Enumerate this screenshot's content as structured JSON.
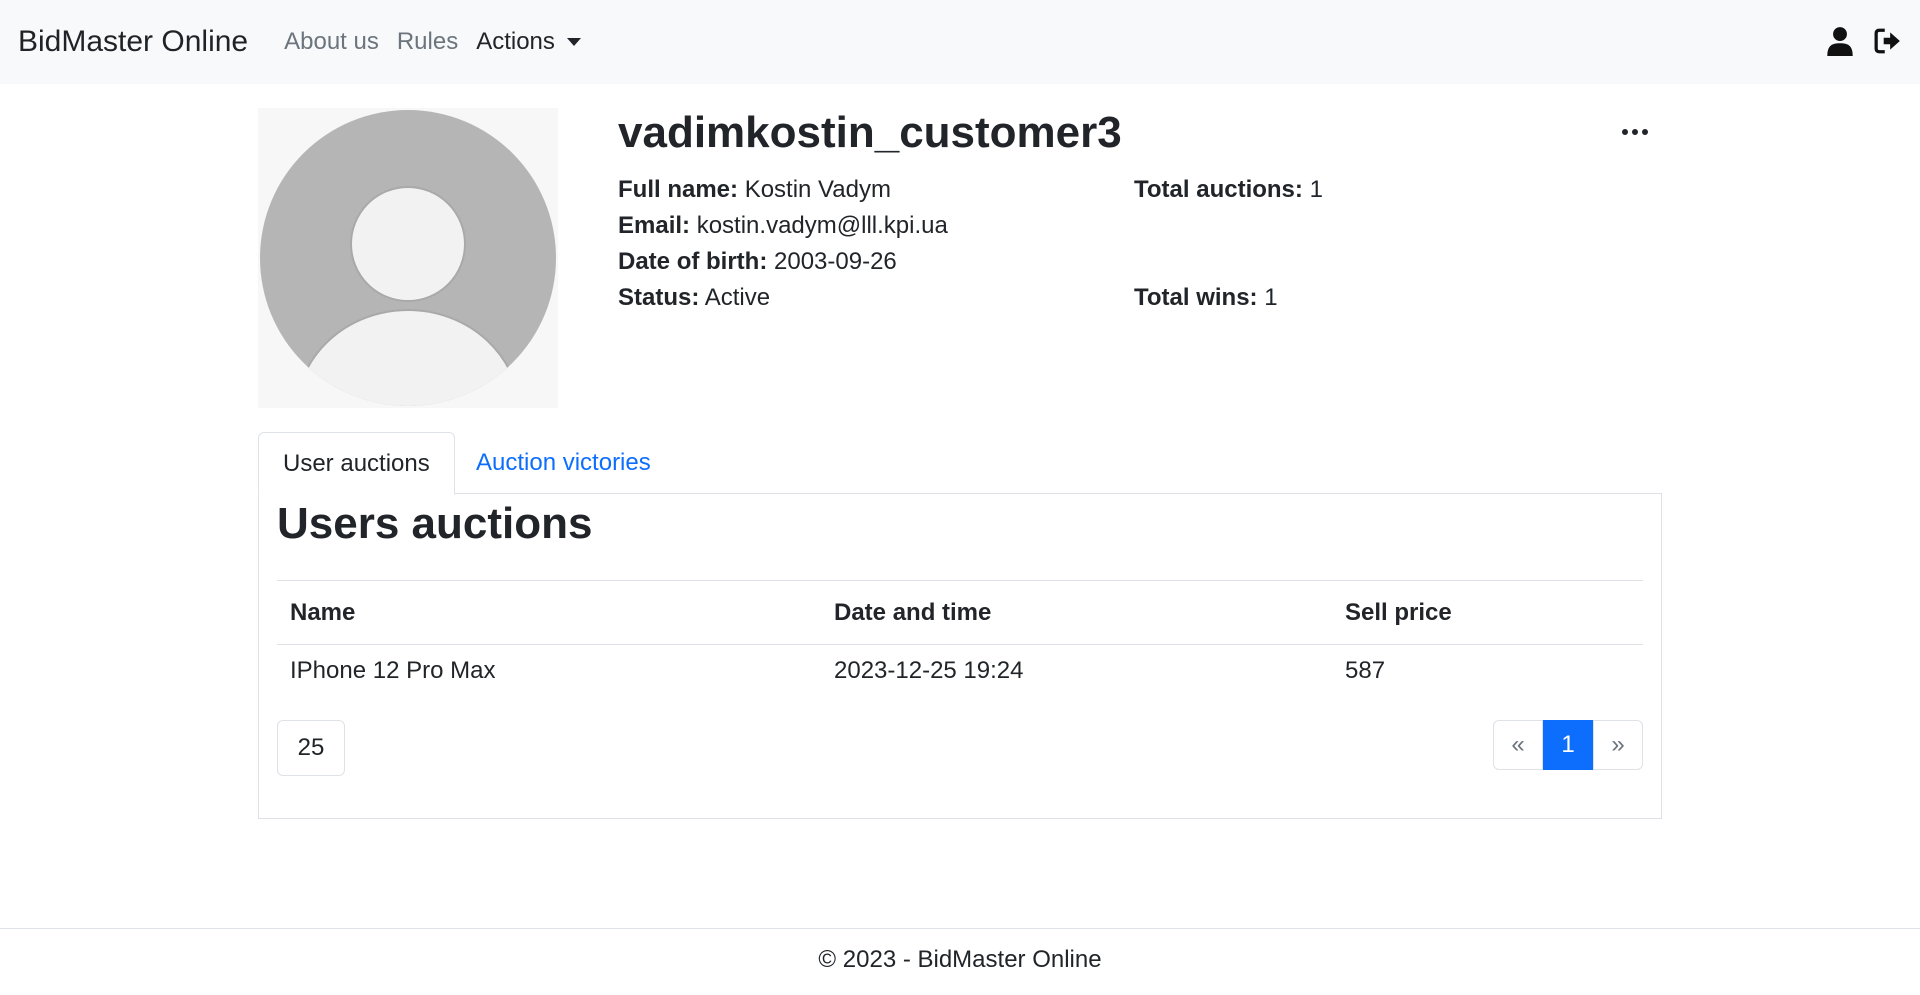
{
  "navbar": {
    "brand": "BidMaster Online",
    "links": [
      "About us",
      "Rules"
    ],
    "actions_label": "Actions",
    "right_icons": [
      "user-icon",
      "logout-icon"
    ]
  },
  "profile": {
    "username": "vadimkostin_customer3",
    "full_name_label": "Full name:",
    "full_name": "Kostin Vadym",
    "email_label": "Email:",
    "email": "kostin.vadym@lll.kpi.ua",
    "dob_label": "Date of birth:",
    "dob": "2003-09-26",
    "status_label": "Status:",
    "status": "Active",
    "total_auctions_label": "Total auctions:",
    "total_auctions": "1",
    "total_wins_label": "Total wins:",
    "total_wins": "1"
  },
  "tabs": [
    "User auctions",
    "Auction victories"
  ],
  "panel": {
    "title": "Users auctions",
    "columns": [
      "Name",
      "Date and time",
      "Sell price"
    ],
    "rows": [
      [
        "IPhone 12 Pro Max",
        "2023-12-25 19:24",
        "587"
      ]
    ],
    "page_size": "25",
    "pagination": {
      "prev": "«",
      "current": "1",
      "next": "»"
    }
  },
  "footer": {
    "text": "© 2023 - BidMaster Online"
  },
  "colors": {
    "accent": "#0d6efd",
    "navbar_bg": "#f8f9fa",
    "avatar_gray": "#b5b5b5"
  }
}
